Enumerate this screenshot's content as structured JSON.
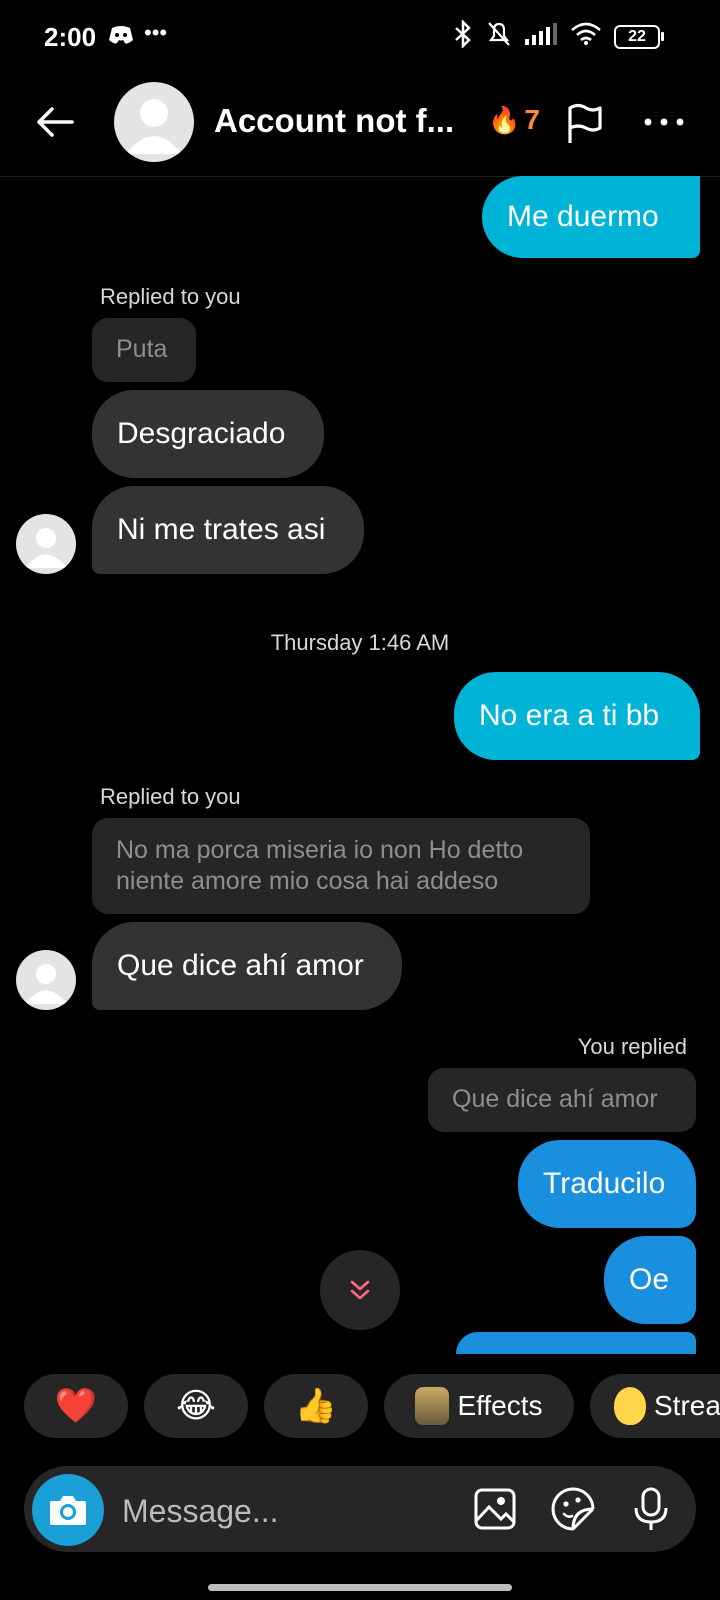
{
  "status_bar": {
    "time": "2:00",
    "battery": "22",
    "icons": [
      "discord-icon",
      "more-dots-icon",
      "bluetooth-icon",
      "bell-muted-icon",
      "signal-icon",
      "wifi-icon",
      "battery-icon"
    ]
  },
  "header": {
    "title": "Account not f...",
    "streak_count": "7",
    "icons": [
      "back-arrow-icon",
      "flag-icon",
      "more-icon"
    ]
  },
  "messages": {
    "m1": "Me duermo",
    "reply_label_1": "Replied to you",
    "quote_1": "Puta",
    "m2": "Desgraciado",
    "m3": "Ni me trates asi",
    "timestamp": "Thursday 1:46 AM",
    "m4": "No era a ti bb",
    "reply_label_2": "Replied to you",
    "quote_2_line1": "No ma porca miseria io non Ho detto",
    "quote_2_line2": "niente amore mio cosa hai addeso",
    "m5": "Que dice ahí amor",
    "reply_label_3": "You replied",
    "quote_3": "Que dice ahí amor",
    "m6": "Traducilo",
    "m7": "Oe"
  },
  "reactions": {
    "heart": "❤️",
    "laugh": "😂",
    "thumbs": "👍",
    "effects_label": "Effects",
    "streak_label": "Strea"
  },
  "composer": {
    "placeholder": "Message..."
  },
  "colors": {
    "outgoing": "#00b4d8",
    "outgoing_alt": "#1a8fdd",
    "incoming": "#333334",
    "quote": "#262627",
    "streak": "#ff8a3d"
  }
}
